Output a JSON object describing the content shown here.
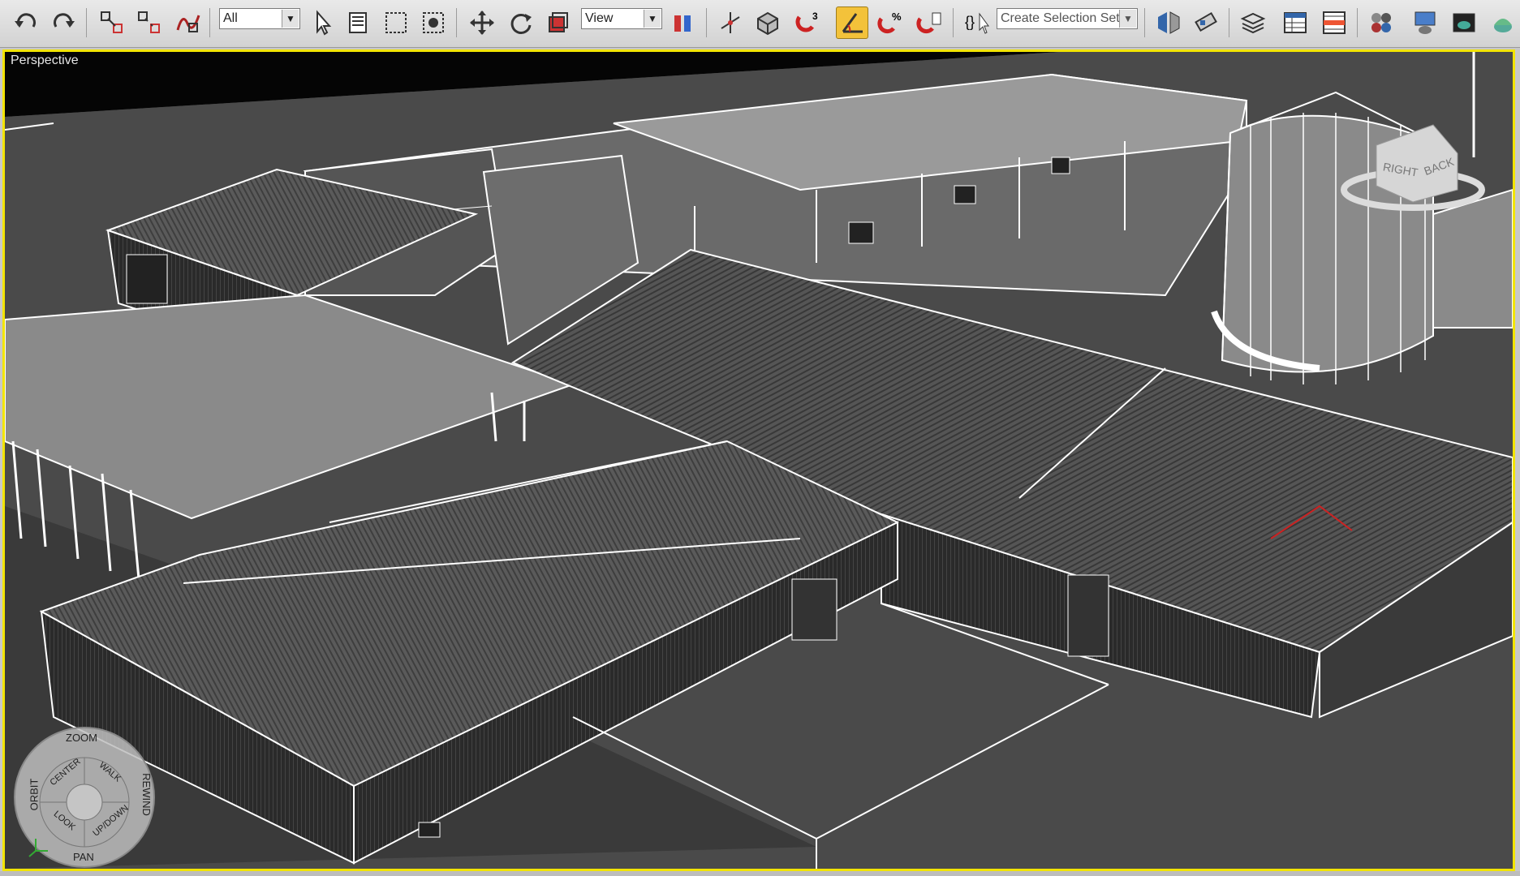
{
  "toolbar": {
    "selection_filter": "All",
    "reference_coord": "View",
    "named_selection_placeholder": "Create Selection Set"
  },
  "viewport": {
    "label": "Perspective",
    "border_color": "#f2e400"
  },
  "viewcube": {
    "face_right": "RIGHT",
    "face_back": "BACK"
  },
  "navwheel": {
    "zoom": "ZOOM",
    "orbit": "ORBIT",
    "rewind": "REWIND",
    "pan": "PAN",
    "center": "CENTER",
    "walk": "WALK",
    "look": "LOOK",
    "updown": "UP/DOWN"
  },
  "icons": [
    "undo-icon",
    "redo-icon",
    "select-link-icon",
    "unlink-icon",
    "bind-space-warp-icon",
    "select-object-icon",
    "select-by-name-icon",
    "rect-region-icon",
    "window-crossing-icon",
    "move-icon",
    "rotate-icon",
    "scale-icon",
    "pivot-icon",
    "manipulate-icon",
    "keyboard-shortcut-icon",
    "snap-3-icon",
    "angle-snap-icon",
    "percent-snap-icon",
    "spinner-snap-icon",
    "edit-named-sets-icon",
    "mirror-icon",
    "align-icon",
    "layer-manager-icon",
    "graphite-ribbon-icon",
    "curve-editor-icon",
    "schematic-view-icon",
    "material-editor-icon",
    "render-setup-icon",
    "rendered-frame-icon",
    "render-icon"
  ],
  "colors": {
    "toolbar_bg": "#dcdcdc",
    "active_tool": "#f3c23a",
    "ground": "#3b3b3b",
    "wire": "#ffffff"
  }
}
